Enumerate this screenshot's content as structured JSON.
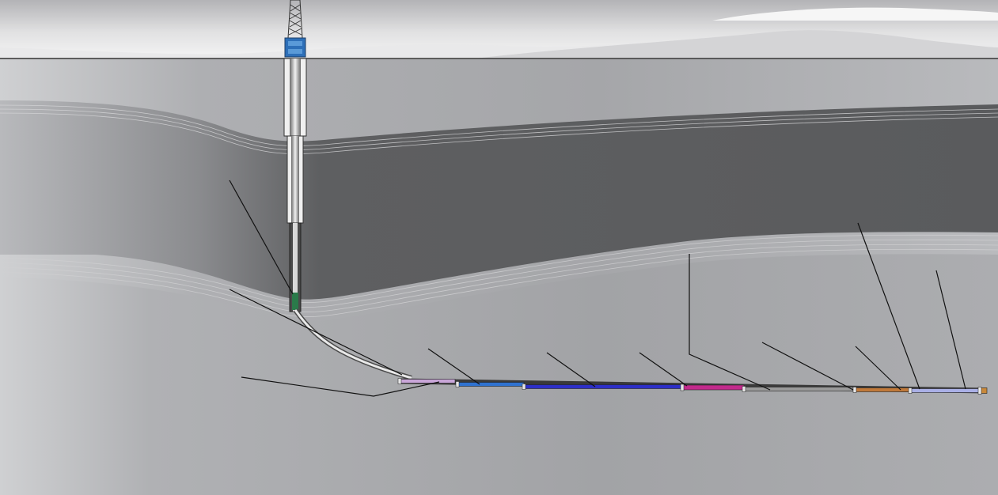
{
  "title": "",
  "labels": [],
  "layers": [
    {
      "name": "sky"
    },
    {
      "name": "overburden"
    },
    {
      "name": "upper-formation"
    },
    {
      "name": "shale-band"
    },
    {
      "name": "lower-formation"
    }
  ],
  "bha_components": [
    {
      "name": "curve-section",
      "color": "#c9a6d8"
    },
    {
      "name": "mwd-tool",
      "color": "#2f72d0"
    },
    {
      "name": "drill-pipe-blue",
      "color": "#2d2fc8"
    },
    {
      "name": "magenta-tool",
      "color": "#c22a8c"
    },
    {
      "name": "grey-tool",
      "color": "#9a9a9a"
    },
    {
      "name": "copper-tool",
      "color": "#c0793a"
    },
    {
      "name": "lavender-tool",
      "color": "#aab0e6"
    },
    {
      "name": "bit",
      "color": "#c8883a"
    }
  ],
  "colors": {
    "sky_top": "#bdbdc0",
    "sky_bottom": "#f2f2f2",
    "ground": "#b6b7bb",
    "formation_dark": "#5f6062",
    "formation_light": "#c2c3c6",
    "pointer_lines": "#111111"
  }
}
